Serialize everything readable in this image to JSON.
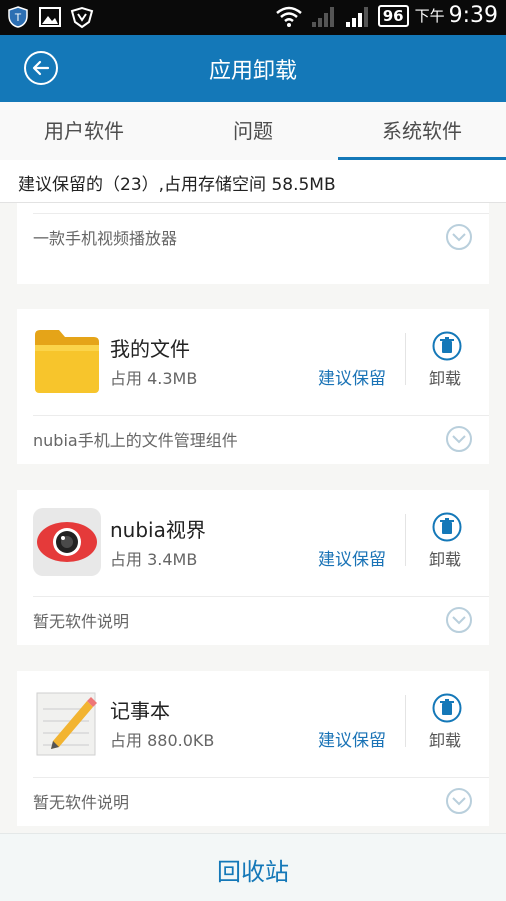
{
  "status_bar": {
    "battery": "96",
    "ampm": "下午",
    "time": "9:39"
  },
  "header": {
    "title": "应用卸载"
  },
  "tabs": [
    {
      "label": "用户软件",
      "active": false
    },
    {
      "label": "问题",
      "active": false
    },
    {
      "label": "系统软件",
      "active": true
    }
  ],
  "summary": {
    "text": "建议保留的（23）,占用存储空间 58.5MB"
  },
  "apps": [
    {
      "description": "一款手机视频播放器",
      "icon": "video-player-icon"
    },
    {
      "name": "我的文件",
      "size": "占用 4.3MB",
      "action_link": "建议保留",
      "uninstall_label": "卸载",
      "description": "nubia手机上的文件管理组件",
      "icon": "folder-icon"
    },
    {
      "name": "nubia视界",
      "size": "占用 3.4MB",
      "action_link": "建议保留",
      "uninstall_label": "卸载",
      "description": "暂无软件说明",
      "icon": "camera-eye-icon"
    },
    {
      "name": "记事本",
      "size": "占用 880.0KB",
      "action_link": "建议保留",
      "uninstall_label": "卸载",
      "description": "暂无软件说明",
      "icon": "notepad-icon"
    }
  ],
  "footer": {
    "recycle_label": "回收站"
  },
  "colors": {
    "primary": "#1478b8",
    "link": "#1a73b6"
  }
}
